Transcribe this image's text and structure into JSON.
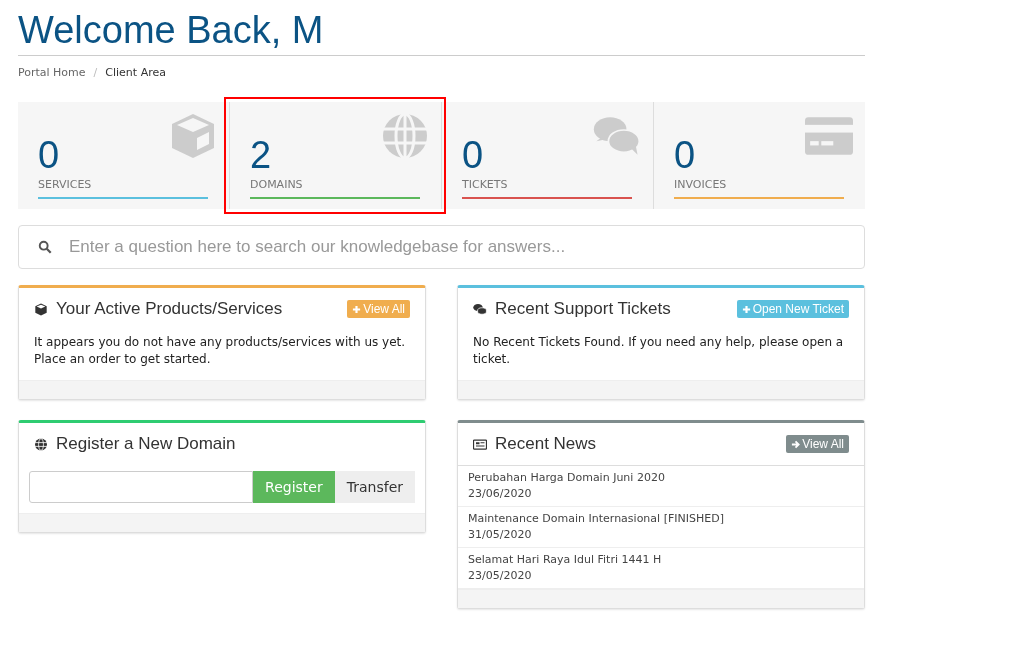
{
  "title": "Welcome Back, M",
  "breadcrumb": [
    {
      "label": "Portal Home",
      "selected": false
    },
    {
      "label": "Client Area",
      "selected": true
    }
  ],
  "breadcrumb_separator": "/",
  "stats": [
    {
      "count": "0",
      "label": "SERVICES",
      "kind": "services",
      "color": "#5bc0de",
      "highlighted": false
    },
    {
      "count": "2",
      "label": "DOMAINS",
      "kind": "domains",
      "color": "#5cb85c",
      "highlighted": true
    },
    {
      "count": "0",
      "label": "TICKETS",
      "kind": "tickets",
      "color": "#d9534f",
      "highlighted": false
    },
    {
      "count": "0",
      "label": "INVOICES",
      "kind": "invoices",
      "color": "#f0ad4e",
      "highlighted": false
    }
  ],
  "search": {
    "placeholder": "Enter a question here to search our knowledgebase for answers..."
  },
  "columns": [
    [
      {
        "kind": "products",
        "title": "Your Active Products/Services",
        "color": "#f0ad4e",
        "button": {
          "label": "View All",
          "color": "#f0ad4e"
        },
        "text": "It appears you do not have any products/services with us yet. Place an order to get started."
      },
      {
        "kind": "domain",
        "title": "Register a New Domain",
        "color": "#2ecc71",
        "buttons": [
          {
            "label": "Register",
            "selected": true
          },
          {
            "label": "Transfer",
            "selected": false
          }
        ]
      }
    ],
    [
      {
        "kind": "tickets",
        "title": "Recent Support Tickets",
        "color": "#5bc0de",
        "button": {
          "label": "Open New Ticket",
          "color": "#5bc0de"
        },
        "text": "No Recent Tickets Found. If you need any help, please open a ticket."
      },
      {
        "kind": "news",
        "title": "Recent News",
        "color": "#7f8c8d",
        "button": {
          "label": "View All",
          "color": "#7f8c8d"
        },
        "items": [
          {
            "title": "Perubahan Harga Domain Juni 2020",
            "date": "23/06/2020"
          },
          {
            "title": "Maintenance Domain Internasional [FINISHED]",
            "date": "31/05/2020"
          },
          {
            "title": "Selamat Hari Raya Idul Fitri 1441 H",
            "date": "23/05/2020"
          }
        ]
      }
    ]
  ]
}
